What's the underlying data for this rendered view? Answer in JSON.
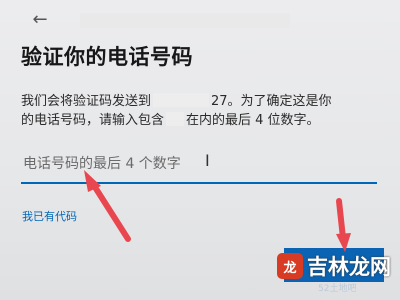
{
  "header": {
    "back_icon": "arrow-left-icon"
  },
  "page": {
    "title": "验证你的电话号码",
    "description_line1_start": "我们会将验证码发送到",
    "description_line1_end": "27。为了确定这是你",
    "description_line2_start": "的电话号码，请输入包含",
    "description_line2_end": "在内的最后 4 位数字。"
  },
  "form": {
    "phone_input_placeholder": "电话号码的最后 4 个数字",
    "cursor_glyph": "I"
  },
  "links": {
    "have_code": "我已有代码"
  },
  "buttons": {
    "next": ""
  },
  "annotations": {
    "arrow_color": "#e8474f"
  },
  "watermark": {
    "logo_text": "龙",
    "brand": "吉林龙网",
    "sub": "52土地吧"
  },
  "colors": {
    "accent": "#0067b8"
  }
}
